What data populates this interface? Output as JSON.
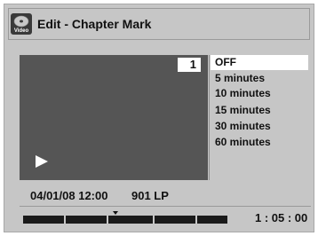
{
  "window": {
    "title": "Edit - Chapter Mark",
    "icon_label": "Video",
    "icon": "video-disc-icon"
  },
  "video": {
    "chapter_number": "1",
    "play_icon": "play-icon"
  },
  "options": {
    "items": [
      "OFF",
      "5 minutes",
      "10 minutes",
      "15 minutes",
      "30 minutes",
      "60 minutes"
    ],
    "selected": "OFF"
  },
  "info": {
    "datetime": "04/01/08 12:00",
    "recording": "901  LP"
  },
  "timeline": {
    "segments": 8,
    "time": "1 : 05 : 00"
  },
  "colors": {
    "background": "#c6c6c6",
    "video_area": "#555555",
    "selected_option": "#ffffff",
    "timeline_segment": "#1a1a1a"
  }
}
